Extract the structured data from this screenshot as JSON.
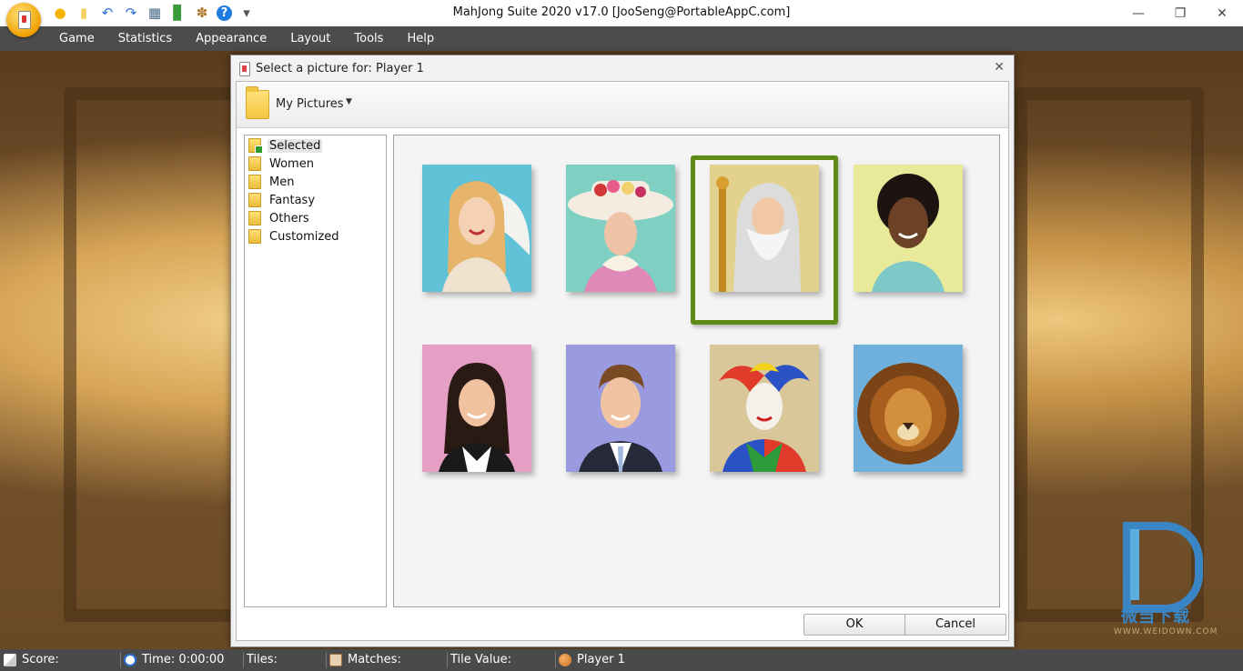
{
  "window": {
    "title": "MahJong Suite 2020 v17.0  [JooSeng@PortableAppC.com]",
    "controls": [
      "—",
      "❐",
      "✕"
    ]
  },
  "quick_access": [
    {
      "name": "new-game-icon",
      "glyph": "●",
      "color": "#f5b400"
    },
    {
      "name": "tile-icon",
      "glyph": "▮",
      "color": "#f4d060"
    },
    {
      "name": "undo-icon",
      "glyph": "↶",
      "color": "#2b6fd6"
    },
    {
      "name": "redo-icon",
      "glyph": "↷",
      "color": "#2b6fd6"
    },
    {
      "name": "layout-icon",
      "glyph": "▦",
      "color": "#4a6a8a"
    },
    {
      "name": "statistics-icon",
      "glyph": "▊",
      "color": "#3a9a3a"
    },
    {
      "name": "palette-icon",
      "glyph": "✽",
      "color": "#b07a30"
    },
    {
      "name": "help-icon",
      "glyph": "?",
      "color": "#1e7be0"
    },
    {
      "name": "customize-icon",
      "glyph": "▾",
      "color": "#555555"
    }
  ],
  "menu": [
    "Game",
    "Statistics",
    "Appearance",
    "Layout",
    "Tools",
    "Help"
  ],
  "dialog": {
    "title": "Select a picture for: Player 1",
    "source": "My Pictures",
    "categories": [
      "Selected",
      "Women",
      "Men",
      "Fantasy",
      "Others",
      "Customized"
    ],
    "selected_category": "Selected",
    "pictures": [
      {
        "name": "angel-woman-picture"
      },
      {
        "name": "hat-lady-picture"
      },
      {
        "name": "wizard-picture",
        "selected": true
      },
      {
        "name": "smiling-woman-picture"
      },
      {
        "name": "business-woman-picture"
      },
      {
        "name": "business-man-picture"
      },
      {
        "name": "jester-picture"
      },
      {
        "name": "lion-picture"
      }
    ],
    "ok_label": "OK",
    "cancel_label": "Cancel"
  },
  "status": {
    "score_label": "Score:",
    "time_label": "Time: 0:00:00",
    "tiles_label": "Tiles:",
    "matches_label": "Matches:",
    "tile_value_label": "Tile Value:",
    "player_label": "Player 1"
  },
  "watermark": {
    "chinese": "微当下载",
    "url": "WWW.WEIDOWN.COM"
  },
  "colors": {
    "menubar": "#4c4c4c",
    "selection_frame": "#5f8a16",
    "watermark": "#3a86c4"
  }
}
